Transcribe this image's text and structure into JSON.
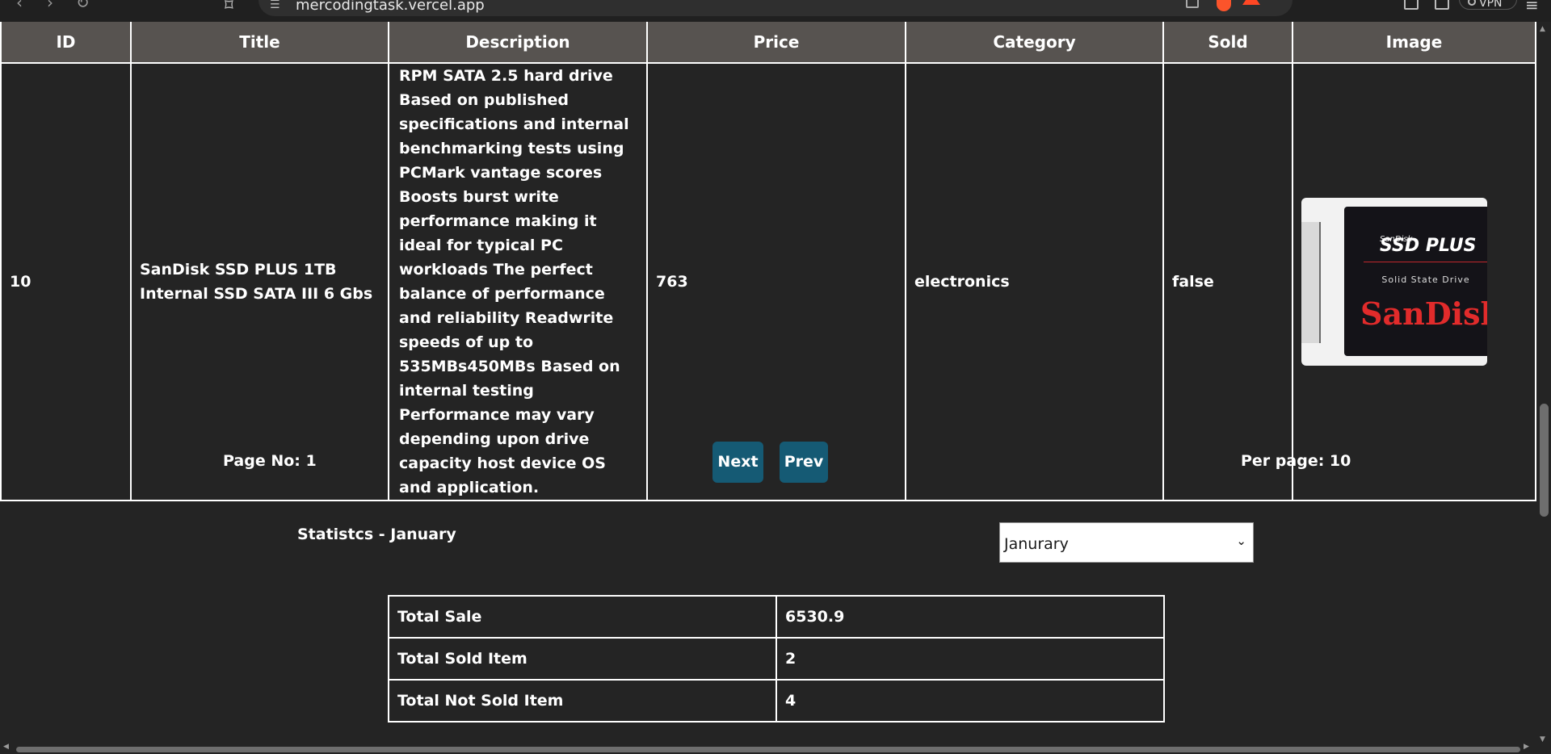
{
  "browser": {
    "url": "mercodingtask.vercel.app",
    "vpn_label": "VPN",
    "icons": [
      "back-icon",
      "forward-icon",
      "reload-icon",
      "bookmark-icon",
      "site-settings-icon",
      "share-icon",
      "brave-shields-icon",
      "brave-rewards-icon",
      "sidebar-icon",
      "wallet-icon",
      "menu-icon"
    ]
  },
  "table": {
    "headers": [
      "ID",
      "Title",
      "Description",
      "Price",
      "Category",
      "Sold",
      "Image"
    ],
    "rows": [
      {
        "id": "10",
        "title": "SanDisk SSD PLUS 1TB Internal SSD SATA III 6 Gbs",
        "description": "RPM SATA 2.5 hard drive Based on published specifications and internal benchmarking tests using PCMark vantage scores Boosts burst write performance making it ideal for typical PC workloads The perfect balance of performance and reliability Readwrite speeds of up to 535MBs450MBs Based on internal testing Performance may vary depending upon drive capacity host device OS and application.",
        "price": "763",
        "category": "electronics",
        "sold": "false",
        "image": {
          "brand_small": "SanDisk",
          "model": "SSD PLUS",
          "type": "Solid State Drive",
          "brand": "SanDisk"
        }
      }
    ]
  },
  "pagination": {
    "page_no": "Page No: 1",
    "next_label": "Next",
    "prev_label": "Prev",
    "per_page": "Per page: 10"
  },
  "statistics": {
    "title": "Statistcs - January",
    "month_selected": "Janurary",
    "rows": [
      {
        "label": "Total Sale",
        "value": "6530.9"
      },
      {
        "label": "Total Sold Item",
        "value": "2"
      },
      {
        "label": "Total Not Sold Item",
        "value": "4"
      }
    ]
  },
  "colors": {
    "background": "#242424",
    "table_header": "#575350",
    "button": "#155a74",
    "brand_red": "#e12b2b"
  }
}
